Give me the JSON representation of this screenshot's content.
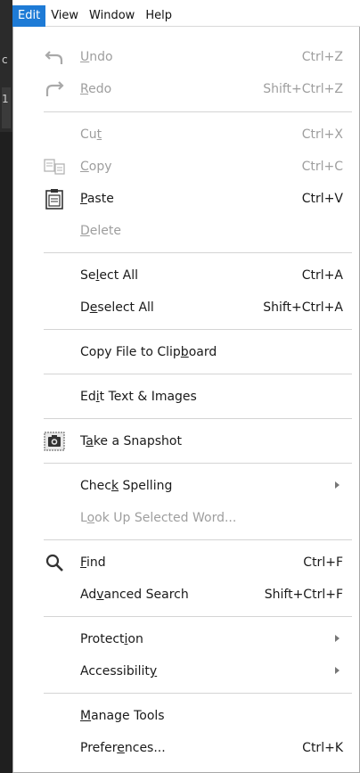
{
  "menubar": {
    "items": [
      {
        "label": "Edit",
        "active": true
      },
      {
        "label": "View",
        "active": false
      },
      {
        "label": "Window",
        "active": false
      },
      {
        "label": "Help",
        "active": false
      }
    ]
  },
  "background_strip": {
    "char1": "c",
    "char2": "1"
  },
  "menu": {
    "undo": {
      "pre": "",
      "u": "U",
      "post": "ndo",
      "shortcut": "Ctrl+Z"
    },
    "redo": {
      "pre": "",
      "u": "R",
      "post": "edo",
      "shortcut": "Shift+Ctrl+Z"
    },
    "cut": {
      "pre": "Cu",
      "u": "t",
      "post": "",
      "shortcut": "Ctrl+X"
    },
    "copy": {
      "pre": "",
      "u": "C",
      "post": "opy",
      "shortcut": "Ctrl+C"
    },
    "paste": {
      "pre": "",
      "u": "P",
      "post": "aste",
      "shortcut": "Ctrl+V"
    },
    "delete": {
      "pre": "",
      "u": "D",
      "post": "elete",
      "shortcut": ""
    },
    "select_all": {
      "pre": "Se",
      "u": "l",
      "post": "ect All",
      "shortcut": "Ctrl+A"
    },
    "deselect_all": {
      "pre": "D",
      "u": "e",
      "post": "select All",
      "shortcut": "Shift+Ctrl+A"
    },
    "copy_file": {
      "pre": "Copy File to Clip",
      "u": "b",
      "post": "oard",
      "shortcut": ""
    },
    "edit_text": {
      "pre": "Ed",
      "u": "i",
      "post": "t Text & Images",
      "shortcut": ""
    },
    "snapshot": {
      "pre": "T",
      "u": "a",
      "post": "ke a Snapshot",
      "shortcut": ""
    },
    "check_spelling": {
      "pre": "Chec",
      "u": "k",
      "post": " Spelling",
      "shortcut": ""
    },
    "lookup": {
      "pre": "L",
      "u": "o",
      "post": "ok Up Selected Word...",
      "shortcut": ""
    },
    "find": {
      "pre": "",
      "u": "F",
      "post": "ind",
      "shortcut": "Ctrl+F"
    },
    "advanced_search": {
      "pre": "Ad",
      "u": "v",
      "post": "anced Search",
      "shortcut": "Shift+Ctrl+F"
    },
    "protection": {
      "pre": "Protect",
      "u": "i",
      "post": "on",
      "shortcut": ""
    },
    "accessibility": {
      "pre": "Accessibilit",
      "u": "y",
      "post": "",
      "shortcut": ""
    },
    "manage_tools": {
      "pre": "",
      "u": "M",
      "post": "anage Tools",
      "shortcut": ""
    },
    "preferences": {
      "pre": "Prefer",
      "u": "e",
      "post": "nces...",
      "shortcut": "Ctrl+K"
    }
  },
  "colors": {
    "accent": "#1e7bd6",
    "disabled": "#9e9e9e",
    "separator": "#d4d4d4"
  }
}
